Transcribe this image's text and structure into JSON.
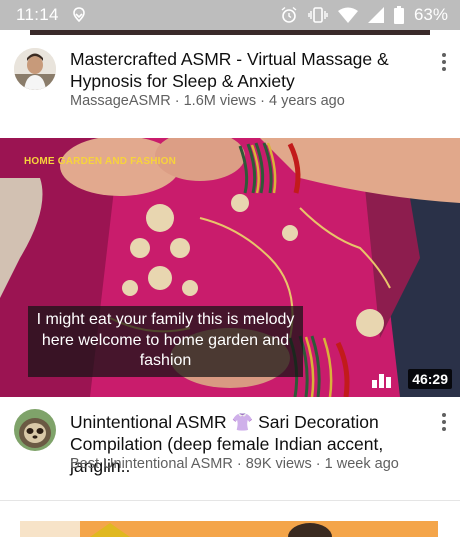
{
  "status_bar": {
    "time": "11:14",
    "battery": "63%",
    "icons": [
      "location-icon",
      "alarm-icon",
      "vibrate-icon",
      "wifi-icon",
      "signal-icon",
      "battery-icon"
    ]
  },
  "videos": [
    {
      "title": "Mastercrafted ASMR -  Virtual Massage & Hypnosis for Sleep & Anxiety",
      "meta": "MassageASMR · 1.6M views · 4 years ago"
    },
    {
      "thumbnail": {
        "brand_text": "HOME GARDEN AND FASHION",
        "caption": "I might eat your family this is melody here welcome to home garden and fashion",
        "duration": "46:29"
      },
      "title": "Unintentional ASMR 👚 Sari Decoration Compilation (deep female Indian accent, janglin..",
      "meta": "Best Unintentional ASMR · 89K views · 1 week ago"
    }
  ],
  "colors": {
    "status_bar_bg": "#bdbdbd",
    "sari_pink": "#d11f73",
    "caption_bg": "#141414",
    "meta_text": "#606060",
    "brand_text": "#f7d33c",
    "next_thumb": "#f4a54a"
  }
}
